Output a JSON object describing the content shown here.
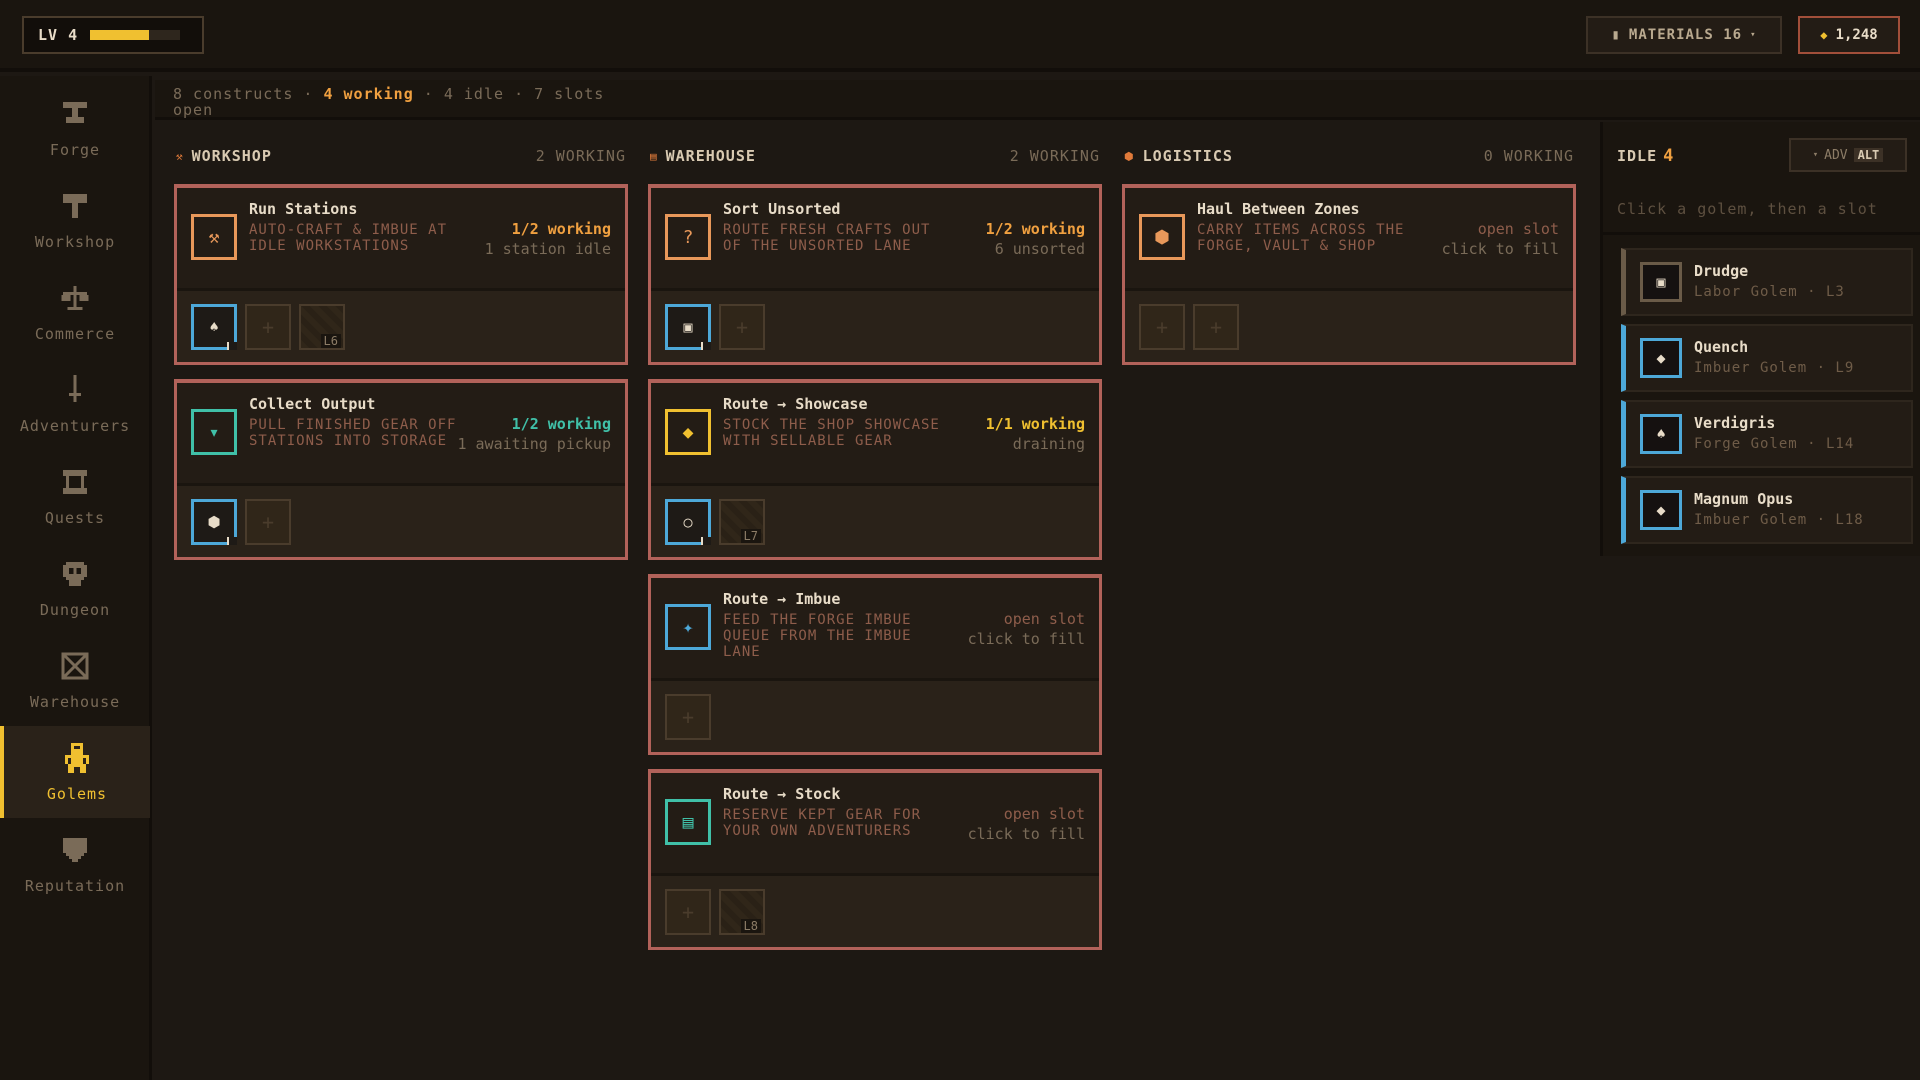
{
  "topbar": {
    "level": "LV 4",
    "level_progress": 0.65,
    "materials_label": "MATERIALS 16",
    "gold": "1,248"
  },
  "nav": [
    {
      "label": "Forge",
      "icon": "anvil-icon"
    },
    {
      "label": "Workshop",
      "icon": "hammer-icon"
    },
    {
      "label": "Commerce",
      "icon": "scales-icon"
    },
    {
      "label": "Adventurers",
      "icon": "sword-icon"
    },
    {
      "label": "Quests",
      "icon": "scroll-icon"
    },
    {
      "label": "Dungeon",
      "icon": "skull-icon"
    },
    {
      "label": "Warehouse",
      "icon": "crate-icon"
    },
    {
      "label": "Golems",
      "icon": "golem-icon",
      "active": true
    },
    {
      "label": "Reputation",
      "icon": "shield-icon"
    }
  ],
  "summary": {
    "constructs": "8 constructs",
    "sep": "·",
    "working": "4 working",
    "idle": "4 idle",
    "slots": "7 slots",
    "slots_tail": "open"
  },
  "columns": {
    "workshop": {
      "title": "WORKSHOP",
      "count": "2 WORKING"
    },
    "warehouse": {
      "title": "WAREHOUSE",
      "count": "2 WORKING"
    },
    "logistics": {
      "title": "LOGISTICS",
      "count": "0 WORKING"
    }
  },
  "cards": {
    "run_stations": {
      "name": "Run Stations",
      "desc": "AUTO-CRAFT & IMBUE AT IDLE WORKSTATIONS",
      "status": "1/2 working",
      "sub": "1 station idle",
      "locked": "L6"
    },
    "collect_output": {
      "name": "Collect Output",
      "desc": "PULL FINISHED GEAR OFF STATIONS INTO STORAGE",
      "status": "1/2 working",
      "sub": "1 awaiting pickup"
    },
    "sort_unsorted": {
      "name": "Sort Unsorted",
      "desc": "ROUTE FRESH CRAFTS OUT OF THE UNSORTED LANE",
      "status": "1/2 working",
      "sub": "6 unsorted"
    },
    "route_showcase": {
      "name": "Route → Showcase",
      "desc": "STOCK THE SHOP SHOWCASE WITH SELLABLE GEAR",
      "status": "1/1 working",
      "sub": "draining",
      "locked": "L7"
    },
    "route_imbue": {
      "name": "Route → Imbue",
      "desc": "FEED THE FORGE IMBUE QUEUE FROM THE IMBUE LANE",
      "status": "open slot",
      "sub": "click to fill"
    },
    "route_stock": {
      "name": "Route → Stock",
      "desc": "RESERVE KEPT GEAR FOR YOUR OWN ADVENTURERS",
      "status": "open slot",
      "sub": "click to fill",
      "locked": "L8"
    },
    "haul": {
      "name": "Haul Between Zones",
      "desc": "CARRY ITEMS ACROSS THE FORGE, VAULT & SHOP",
      "status": "open slot",
      "sub": "click to fill"
    }
  },
  "idle": {
    "title": "IDLE",
    "count": "4",
    "adv_label": "ADV",
    "adv_key": "ALT",
    "hint": "Click a golem, then a slot",
    "golems": [
      {
        "name": "Drudge",
        "sub": "Labor Golem · L3"
      },
      {
        "name": "Quench",
        "sub": "Imbuer Golem · L9"
      },
      {
        "name": "Verdigris",
        "sub": "Forge Golem · L14"
      },
      {
        "name": "Magnum Opus",
        "sub": "Imbuer Golem · L18"
      }
    ]
  },
  "colors": {
    "accent": "#f0c030",
    "card_border": "#b2625a",
    "working_green": "#40c0a8",
    "working_orange": "#f0a040",
    "slot_blue": "#4da8d8"
  }
}
